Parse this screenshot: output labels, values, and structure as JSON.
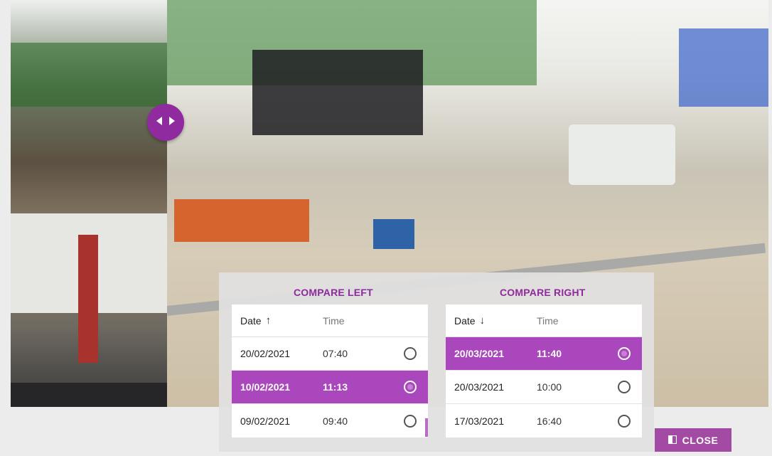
{
  "compare_left": {
    "title": "COMPARE LEFT",
    "date_header": "Date",
    "time_header": "Time",
    "sort_icon": "arrow-up-icon",
    "sort_arrow": "↑",
    "rows": [
      {
        "date": "20/02/2021",
        "time": "07:40",
        "selected": false
      },
      {
        "date": "10/02/2021",
        "time": "11:13",
        "selected": true
      },
      {
        "date": "09/02/2021",
        "time": "09:40",
        "selected": false
      }
    ]
  },
  "compare_right": {
    "title": "COMPARE RIGHT",
    "date_header": "Date",
    "time_header": "Time",
    "sort_icon": "arrow-down-icon",
    "sort_arrow": "↓",
    "rows": [
      {
        "date": "20/03/2021",
        "time": "11:40",
        "selected": true
      },
      {
        "date": "20/03/2021",
        "time": "10:00",
        "selected": false
      },
      {
        "date": "17/03/2021",
        "time": "16:40",
        "selected": false
      }
    ]
  },
  "close_button": {
    "label": "CLOSE",
    "icon": "compare-icon"
  },
  "slider": {
    "icon": "left-right-arrows-icon"
  },
  "colors": {
    "accent": "#ab47bc",
    "title": "#8e2a9c",
    "handle": "#8f2a9f",
    "button": "#a34aa5"
  }
}
